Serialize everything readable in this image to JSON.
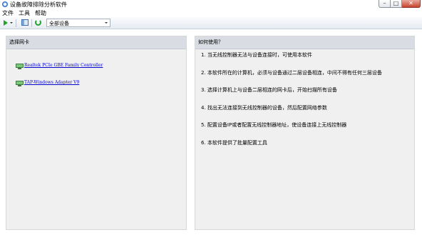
{
  "window": {
    "title": "设备故障排除分析软件",
    "minimize_glyph": "–",
    "maximize_glyph": "□",
    "close_glyph": "✕"
  },
  "menu": [
    "文件",
    "工具",
    "帮助"
  ],
  "toolbar": {
    "device_filter": {
      "selected": "全部设备"
    }
  },
  "left_panel": {
    "header": "选择网卡",
    "adapters": [
      {
        "name": "Realtek PCIe GBE Family Controller"
      },
      {
        "name": "TAP-Windows Adapter V9"
      }
    ]
  },
  "right_panel": {
    "header": "如何使用？",
    "steps": [
      "1. 当无线控制器无法与设备连接时，可使用本软件",
      "2. 本软件所在的计算机，必须与设备通过二层设备相连，中间不得有任何三层设备",
      "3. 选择计算机上与设备二层相连的网卡后，开始扫描所有设备",
      "4. 找出无法连接到无线控制器的设备，然后配置网络参数",
      "5. 配置设备IP或者配置无线控制器地址，使设备连接上无线控制器",
      "6. 本软件提供了批量配置工具"
    ]
  },
  "icons": {
    "app": "app-icon",
    "start_scan": "play-icon",
    "view": "window-icon",
    "refresh": "refresh-icon",
    "adapter": "network-adapter-icon"
  },
  "colors": {
    "play": "#1ea42a",
    "link": "#0000cc",
    "panel_bg": "#f0f0f0",
    "panel_header_bg": "#d9dde3",
    "close_button": "#c7432e"
  }
}
